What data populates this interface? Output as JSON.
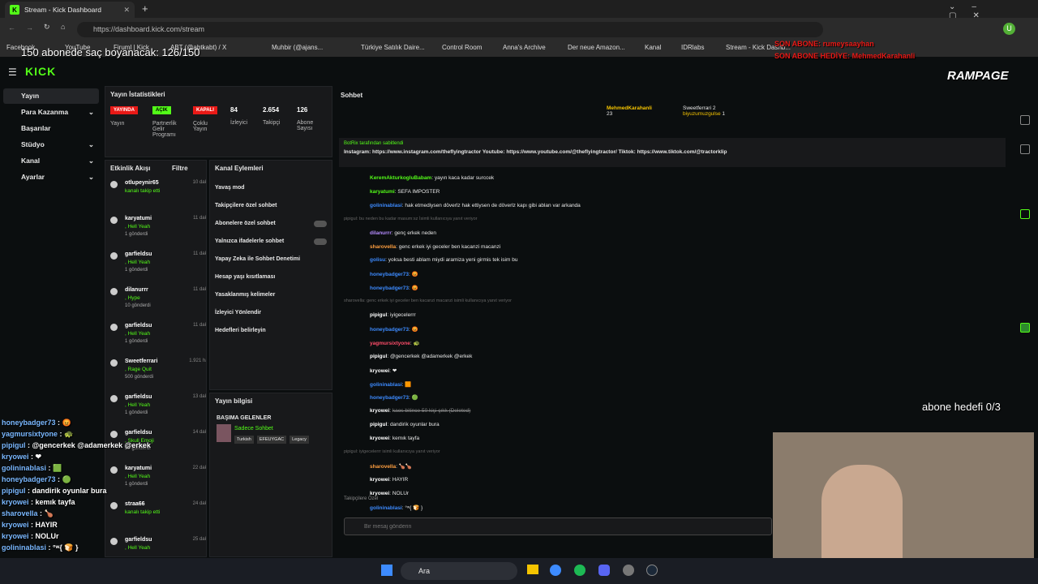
{
  "browser": {
    "tab_title": "Stream - Kick Dashboard",
    "url": "https://dashboard.kick.com/stream",
    "bookmarks": [
      "Facebook",
      "YouTube",
      "Firuml | Kick",
      "ABT (@abtkabt) / X",
      "",
      "",
      "Muhbir (@ajans...",
      "",
      "Türkiye Satılık Daire...",
      "Control Room",
      "Anna's Archive",
      "Der neue Amazon...",
      "Kanal",
      "IDRlabs",
      "Stream - Kick Dashb..."
    ]
  },
  "overlay": {
    "goal_text": "150 abonede saç boyanacak: 126/150",
    "last_sub": "SON ABONE: rumeysaayhan",
    "last_gift": "SON ABONE HEDİYE: MehmedKarahanli",
    "sub_goal": "abone hedefi 0/3",
    "brand": "RAMPAGE",
    "chat_lines": [
      {
        "u": "honeybadger73",
        "t": "😡"
      },
      {
        "u": "yagmursixtyone",
        "t": "🐢"
      },
      {
        "u": "pipigul",
        "t": "@gencerkek @adamerkek @erkek"
      },
      {
        "u": "kryowei",
        "t": "❤"
      },
      {
        "u": "golininablasi",
        "t": "🟩"
      },
      {
        "u": "honeybadger73",
        "t": "🟢"
      },
      {
        "u": "pipigul",
        "t": "dandirik oyunlar bura"
      },
      {
        "u": "kryowei",
        "t": "kemık tayfa"
      },
      {
        "u": "sharovella",
        "t": "🍗"
      },
      {
        "u": "kryowei",
        "t": "HAYIR"
      },
      {
        "u": "kryowei",
        "t": "NOLUr"
      },
      {
        "u": "golininablasi",
        "t": "°ʷ{ 🍞 }"
      }
    ]
  },
  "kick": {
    "logo": "KICK",
    "nav": [
      {
        "label": "Yayın"
      },
      {
        "label": "Para Kazanma"
      },
      {
        "label": "Başarılar"
      },
      {
        "label": "Stüdyo"
      },
      {
        "label": "Kanal"
      },
      {
        "label": "Ayarlar"
      }
    ],
    "stats": {
      "title": "Yayın İstatistikleri",
      "items": [
        {
          "badge": "YAYINDA",
          "label": "Yayın",
          "color": "#e91916"
        },
        {
          "badge": "AÇIK",
          "label": "Partnerlik Gelir Programı",
          "color": "#53fc18"
        },
        {
          "badge": "KAPALI",
          "label": "Çoklu Yayın",
          "color": "#e91916"
        },
        {
          "value": "84",
          "label": "İzleyici"
        },
        {
          "value": "2.654",
          "label": "Takipçi"
        },
        {
          "value": "126",
          "label": "Abone Sayısı"
        }
      ]
    },
    "activity": {
      "title": "Etkinlik Akışı",
      "filter": "Filtre",
      "items": [
        {
          "name": "otlupeynir65",
          "sub": "kanalı takip etti",
          "time": "10 dakika önce"
        },
        {
          "name": "karyatumi",
          "sub": ", Hell Yeah",
          "extra": "1 gönderdi",
          "time": "11 dakika önce"
        },
        {
          "name": "garfieldsu",
          "sub": ", Hell Yeah",
          "extra": "1 gönderdi",
          "time": "11 dakika önce"
        },
        {
          "name": "dilanurrr",
          "sub": ", Hype",
          "extra": "10 gönderdi",
          "time": "11 dakika önce"
        },
        {
          "name": "garfieldsu",
          "sub": ", Hell Yeah",
          "extra": "1 gönderdi",
          "time": "11 dakika önce"
        },
        {
          "name": "Sweetferrari",
          "sub": ", Rage Quit",
          "extra": "500 gönderdi",
          "time": "1.921 hafta önce"
        },
        {
          "name": "garfieldsu",
          "sub": ", Hell Yeah",
          "extra": "1 gönderdi",
          "time": "13 dakika önce"
        },
        {
          "name": "garfieldsu",
          "sub": ", Skull Emoji",
          "extra": "50 gönderdi",
          "time": "14 dakika önce"
        },
        {
          "name": "karyatumi",
          "sub": ", Hell Yeah",
          "extra": "1 gönderdi",
          "time": "22 dakika önce"
        },
        {
          "name": "straa66",
          "sub": "kanalı takip etti",
          "time": "24 dakika önce"
        },
        {
          "name": "garfieldsu",
          "sub": ", Hell Yeah",
          "time": "25 dakika önce"
        }
      ]
    },
    "channel_actions": {
      "title": "Kanal Eylemleri",
      "items": [
        "Yavaş mod",
        "Takipçilere özel sohbet",
        "Abonelere özel sohbet",
        "Yalnızca ifadelerle sohbet",
        "Yapay Zeka ile Sohbet Denetimi",
        "Hesap yaşı kısıtlaması",
        "Yasaklanmış kelimeler",
        "İzleyici Yönlendir",
        "Hedefleri belirleyin"
      ]
    },
    "stream_info": {
      "title": "Yayın bilgisi",
      "stream_title": "BAŞIMA GELENLER",
      "category": "Sadece Sohbet",
      "tags": [
        "Turkish",
        "EFEUYGAC",
        "Legacy"
      ]
    },
    "chat": {
      "title": "Sohbet",
      "top_gifters": [
        {
          "name": "MehmedKarahanli",
          "count": "23"
        },
        {
          "name": "Sweetferrari",
          "count": "2"
        },
        {
          "name": "biyuzumuzgulse",
          "count": "1"
        }
      ],
      "pinned_by": "BotRix tarafından sabitlendi",
      "pinned": "Instagram: https://www.instagram.com/theflyingtractor Youtube: https://www.youtube.com/@theflyingtractor/ Tiktok: https://www.tiktok.com/@tractorklip",
      "messages": [
        {
          "u": "KeremAkturkogluBabam",
          "c": "#53fc18",
          "t": "yayın kaca kadar surccek"
        },
        {
          "u": "karyatumi",
          "c": "#53fc18",
          "t": "SEFA IMPOSTER"
        },
        {
          "u": "golininablasi",
          "c": "#3d8bff",
          "t": "hak etmediysen döverlz hak ettiysen de döverlz kapı gibi ablan var arkanda"
        },
        {
          "reply": "pipigul: bu neden bu kadar masum:sz İsimli kullanıcıya yanıt veriyor"
        },
        {
          "u": "dilanurrr",
          "c": "#b58cff",
          "t": "genç erkek neden"
        },
        {
          "u": "sharovella",
          "c": "#ff9f40",
          "t": "genc erkek iyi geceler ben kacanzi macanzi"
        },
        {
          "u": "golisu",
          "c": "#3d8bff",
          "t": "yoksa besti ablam miydi aramiza yeni girmis tek isim bu"
        },
        {
          "u": "honeybadger73",
          "c": "#3d8bff",
          "t": "😡"
        },
        {
          "u": "honeybadger73",
          "c": "#3d8bff",
          "t": "😡"
        },
        {
          "reply": "sharovella: genc erkek iyi geceler ben kacanzi macanzi isimli kullanıcıya yanıt veriyor"
        },
        {
          "u": "pipigul",
          "c": "#fff",
          "t": "iyigecelerrr"
        },
        {
          "u": "honeybadger73",
          "c": "#3d8bff",
          "t": "😡"
        },
        {
          "u": "yagmursixtyone",
          "c": "#ff4d6a",
          "t": "🐢"
        },
        {
          "u": "pipigul",
          "c": "#fff",
          "t": "@gencerkek @adamerkek @erkek"
        },
        {
          "u": "kryowei",
          "c": "#fff",
          "t": "❤"
        },
        {
          "u": "golininablasi",
          "c": "#3d8bff",
          "t": "🟧"
        },
        {
          "u": "honeybadger73",
          "c": "#3d8bff",
          "t": "🟢"
        },
        {
          "u": "kryowei",
          "c": "#fff",
          "t": "kaos bitince 50 kişi çıkk (Deleted)"
        },
        {
          "u": "pipigul",
          "c": "#fff",
          "t": "dandirik oyunlar bura"
        },
        {
          "u": "kryowei",
          "c": "#fff",
          "t": "kemık tayfa"
        },
        {
          "reply": "pipigul: iyigecelerrr isimli kullanıcıya yanıt veriyor"
        },
        {
          "u": "sharovella",
          "c": "#ff9f40",
          "t": "🍗🍗"
        },
        {
          "u": "kryowei",
          "c": "#fff",
          "t": "HAYIR"
        },
        {
          "u": "kryowei",
          "c": "#fff",
          "t": "NOLUr"
        },
        {
          "u": "golininablasi",
          "c": "#3d8bff",
          "t": "°ʷ{ 🍞 }"
        }
      ],
      "followers_only": "Takipçilere Özel",
      "input_placeholder": "Bir mesaj gönderin"
    }
  },
  "taskbar": {
    "search": "Ara"
  },
  "colors": {
    "kick_green": "#53fc18",
    "bg": "#0b0e0f",
    "panel": "#18191b",
    "live_red": "#e91916"
  }
}
